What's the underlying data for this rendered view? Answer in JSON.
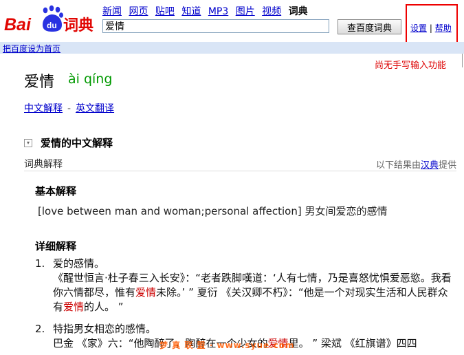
{
  "header": {
    "logo_text": "Bai du 词典",
    "nav": [
      "新闻",
      "网页",
      "贴吧",
      "知道",
      "MP3",
      "图片",
      "视频",
      "词典"
    ],
    "search_value": "爱情",
    "search_button": "查百度词典",
    "settings": "设置",
    "link_sep": "|",
    "help": "帮助",
    "set_home": "把百度设为首页",
    "annotation": "尚无手写输入功能"
  },
  "entry": {
    "word": "爱情",
    "pinyin": "ài qíng",
    "tab_cn": "中文解释",
    "tab_sep": "-",
    "tab_en": "英文翻译",
    "section_title": "爱情的中文解释",
    "sub_left": "词典解释",
    "sub_right_pre": "以下结果由",
    "sub_right_link": "汉典",
    "sub_right_post": "提供",
    "basic_heading": "基本解释",
    "basic_text": "[love between man and woman;personal affection] 男女间爱恋的感情",
    "detail_heading": "详细解释",
    "items": [
      {
        "num": "1.",
        "def": "爱的感情。",
        "q_pre": "《醒世恒言·杜子春三入长安》：“老者跌脚嘆道：‘人有七情，乃是喜怒忧惧爱恶慾。我看你六情都尽，惟有",
        "q_hl1": "爱情",
        "q_mid": "未除。’ ” 夏衍 《关汉卿不朽》：“他是一个对现实生活和人民群众有",
        "q_hl2": "爱情",
        "q_post": "的人。 ”"
      },
      {
        "num": "2.",
        "def": "特指男女相恋的感情。",
        "q_pre": "巴金 《家》六：“他陶醉了，陶醉在一个少女的",
        "q_hl1": "爱情",
        "q_post": "里。 ” 梁斌 《红旗谱》四四"
      }
    ]
  },
  "watermark": "梦 真 联 盟 · www.syue.com",
  "colors": {
    "link": "#0000cc",
    "pinyin": "#009900",
    "highlight": "#cc0000",
    "annotation": "#dd0000",
    "bar": "#d9e5f6"
  }
}
